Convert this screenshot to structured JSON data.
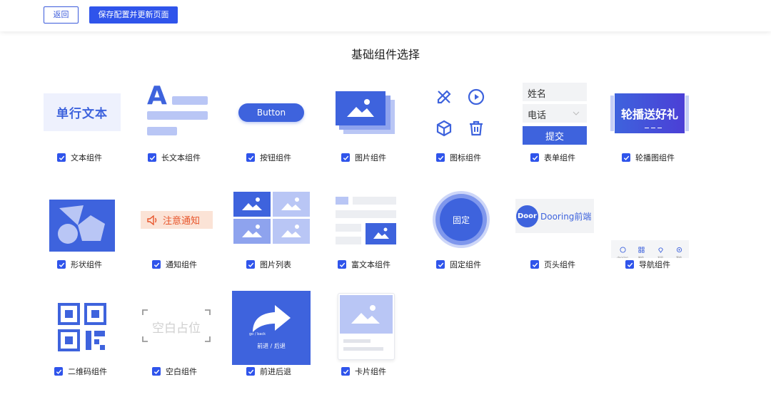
{
  "toolbar": {
    "back_label": "返回",
    "save_label": "保存配置并更新页面"
  },
  "page_title": "基础组件选择",
  "colors": {
    "primary": "#2f54eb",
    "tile_blue": "#3e63dd",
    "tile_light": "#b9c6f5",
    "notice_bg": "#fbe3d6",
    "notice_text": "#e8552b"
  },
  "components": [
    {
      "id": "text",
      "label": "文本组件",
      "checked": true,
      "preview_text": "单行文本"
    },
    {
      "id": "long-text",
      "label": "长文本组件",
      "checked": true,
      "preview_text": "A"
    },
    {
      "id": "button",
      "label": "按钮组件",
      "checked": true,
      "preview_text": "Button"
    },
    {
      "id": "image",
      "label": "图片组件",
      "checked": true
    },
    {
      "id": "icon",
      "label": "图标组件",
      "checked": true,
      "icons": [
        "pencil-ruler-icon",
        "play-circle-icon",
        "cube-icon",
        "trash-icon"
      ]
    },
    {
      "id": "form",
      "label": "表单组件",
      "checked": true,
      "field_name": "姓名",
      "field_phone": "电话",
      "submit": "提交"
    },
    {
      "id": "carousel",
      "label": "轮播图组件",
      "checked": true,
      "preview_text": "轮播送好礼"
    },
    {
      "id": "shape",
      "label": "形状组件",
      "checked": true
    },
    {
      "id": "notice",
      "label": "通知组件",
      "checked": true,
      "preview_text": "注意通知"
    },
    {
      "id": "image-list",
      "label": "图片列表",
      "checked": true
    },
    {
      "id": "rich-text",
      "label": "富文本组件",
      "checked": true
    },
    {
      "id": "fixed",
      "label": "固定组件",
      "checked": true,
      "preview_text": "固定"
    },
    {
      "id": "header",
      "label": "页头组件",
      "checked": true,
      "logo_text": "Door",
      "brand_text": "Dooring前端"
    },
    {
      "id": "nav",
      "label": "导航组件",
      "checked": true,
      "nav_items": [
        "dooring",
        "制作",
        "发现",
        "我的"
      ]
    },
    {
      "id": "qrcode",
      "label": "二维码组件",
      "checked": true
    },
    {
      "id": "blank",
      "label": "空白组件",
      "checked": true,
      "preview_text": "空白占位"
    },
    {
      "id": "back-forward",
      "label": "前进后退",
      "checked": true,
      "small_text": "go / back",
      "preview_text": "前进 / 后退"
    },
    {
      "id": "card",
      "label": "卡片组件",
      "checked": true
    }
  ]
}
